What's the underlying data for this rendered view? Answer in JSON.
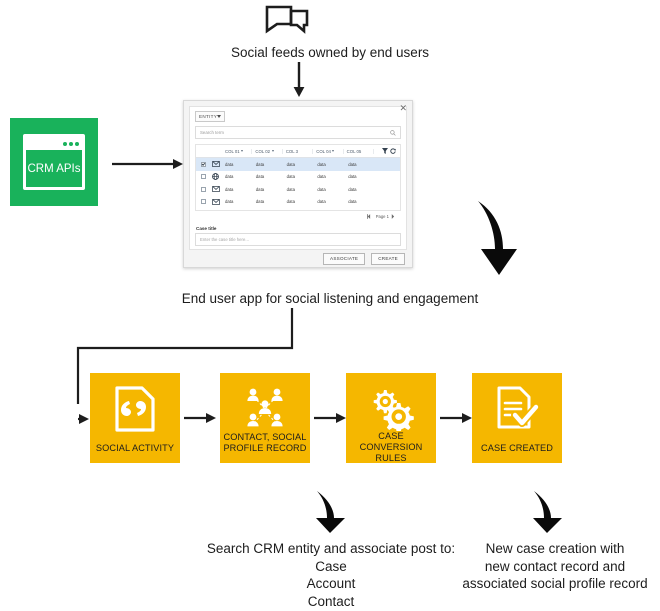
{
  "top": {
    "icon": "chat-bubbles-icon",
    "caption": "Social feeds owned by end users"
  },
  "crm": {
    "label": "CRM APIs",
    "icon": "browser-window-icon",
    "color": "#19b25b"
  },
  "dialog": {
    "entity_selector": "ENTITY",
    "close_label": "✕",
    "search_placeholder": "Search term",
    "search_icon": "magnifier-icon",
    "columns": [
      "COL 01",
      "COL 02",
      "COL 3",
      "COL 04",
      "COL 05"
    ],
    "rows": [
      {
        "icon": "envelope-icon",
        "selected": true,
        "cells": [
          "data",
          "data",
          "data",
          "data",
          "data"
        ]
      },
      {
        "icon": "globe-icon",
        "selected": false,
        "cells": [
          "data",
          "data",
          "data",
          "data",
          "data"
        ]
      },
      {
        "icon": "envelope-icon",
        "selected": false,
        "cells": [
          "data",
          "data",
          "data",
          "data",
          "data"
        ]
      },
      {
        "icon": "envelope-icon",
        "selected": false,
        "cells": [
          "data",
          "data",
          "data",
          "data",
          "data"
        ]
      }
    ],
    "pager": "Page 1",
    "case_title_label": "Case title",
    "case_title_placeholder": "Enter the case title here...",
    "buttons": {
      "associate": "ASSOCIATE",
      "create": "CREATE"
    }
  },
  "middle": {
    "caption": "End user app for social listening and engagement"
  },
  "process": {
    "accent": "#f5b700",
    "steps": [
      {
        "label": "SOCIAL ACTIVITY",
        "icon": "quote-document-icon"
      },
      {
        "label": "CONTACT, SOCIAL PROFILE RECORD",
        "icon": "contacts-network-icon"
      },
      {
        "label": "CASE CONVERSION RULES",
        "icon": "gears-icon"
      },
      {
        "label": "CASE CREATED",
        "icon": "document-check-icon"
      }
    ]
  },
  "bottom": {
    "left_caption": "Search CRM entity and associate post to:\nCase\nAccount\nContact",
    "left_caption_lines": [
      "Search CRM entity and associate post to:",
      "Case",
      "Account",
      "Contact"
    ],
    "right_caption_lines": [
      "New case creation with",
      "new contact record and",
      "associated social profile record"
    ]
  }
}
